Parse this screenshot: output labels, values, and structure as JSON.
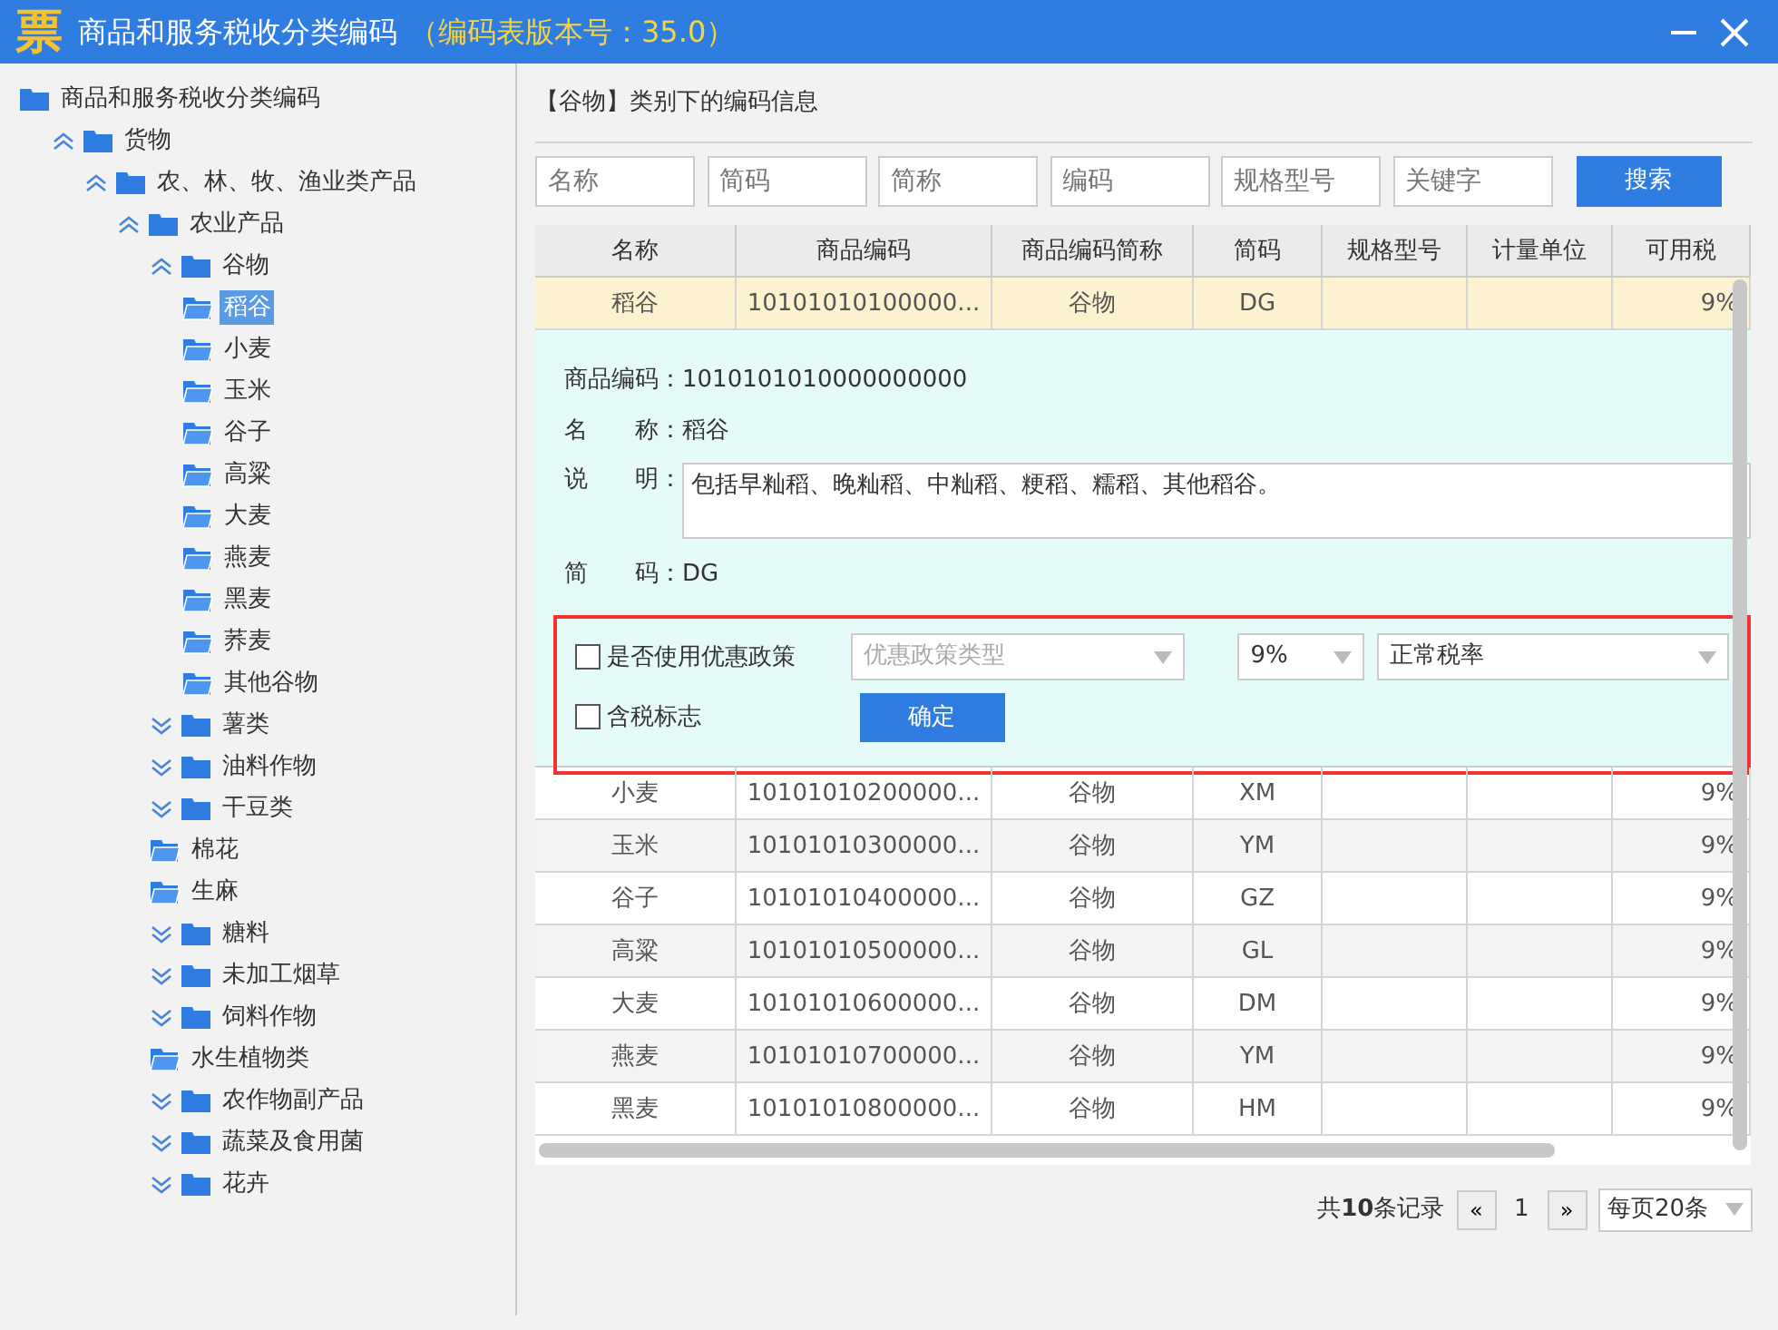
{
  "window": {
    "logo": "票",
    "title": "商品和服务税收分类编码",
    "version": "（编码表版本号：35.0）"
  },
  "tree": [
    {
      "label": "商品和服务税收分类编码",
      "kind": "root",
      "selected": false,
      "children": [
        {
          "label": "货物",
          "kind": "branch",
          "expanded": true,
          "selected": false,
          "children": [
            {
              "label": "农、林、牧、渔业类产品",
              "kind": "branch",
              "expanded": true,
              "selected": false,
              "children": [
                {
                  "label": "农业产品",
                  "kind": "branch",
                  "expanded": true,
                  "selected": false,
                  "children": [
                    {
                      "label": "谷物",
                      "kind": "branch",
                      "expanded": true,
                      "selected": false,
                      "children": [
                        {
                          "label": "稻谷",
                          "kind": "leaf",
                          "selected": true
                        },
                        {
                          "label": "小麦",
                          "kind": "leaf",
                          "selected": false
                        },
                        {
                          "label": "玉米",
                          "kind": "leaf",
                          "selected": false
                        },
                        {
                          "label": "谷子",
                          "kind": "leaf",
                          "selected": false
                        },
                        {
                          "label": "高粱",
                          "kind": "leaf",
                          "selected": false
                        },
                        {
                          "label": "大麦",
                          "kind": "leaf",
                          "selected": false
                        },
                        {
                          "label": "燕麦",
                          "kind": "leaf",
                          "selected": false
                        },
                        {
                          "label": "黑麦",
                          "kind": "leaf",
                          "selected": false
                        },
                        {
                          "label": "荞麦",
                          "kind": "leaf",
                          "selected": false
                        },
                        {
                          "label": "其他谷物",
                          "kind": "leaf",
                          "selected": false
                        }
                      ]
                    },
                    {
                      "label": "薯类",
                      "kind": "branch",
                      "expanded": false,
                      "selected": false
                    },
                    {
                      "label": "油料作物",
                      "kind": "branch",
                      "expanded": false,
                      "selected": false
                    },
                    {
                      "label": "干豆类",
                      "kind": "branch",
                      "expanded": false,
                      "selected": false
                    },
                    {
                      "label": "棉花",
                      "kind": "leaf",
                      "selected": false
                    },
                    {
                      "label": "生麻",
                      "kind": "leaf",
                      "selected": false
                    },
                    {
                      "label": "糖料",
                      "kind": "branch",
                      "expanded": false,
                      "selected": false
                    },
                    {
                      "label": "未加工烟草",
                      "kind": "branch",
                      "expanded": false,
                      "selected": false
                    },
                    {
                      "label": "饲料作物",
                      "kind": "branch",
                      "expanded": false,
                      "selected": false
                    },
                    {
                      "label": "水生植物类",
                      "kind": "leaf",
                      "selected": false
                    },
                    {
                      "label": "农作物副产品",
                      "kind": "branch",
                      "expanded": false,
                      "selected": false
                    },
                    {
                      "label": "蔬菜及食用菌",
                      "kind": "branch",
                      "expanded": false,
                      "selected": false
                    },
                    {
                      "label": "花卉",
                      "kind": "branch",
                      "expanded": false,
                      "selected": false
                    }
                  ]
                }
              ]
            }
          ]
        }
      ]
    }
  ],
  "panel_title": "【谷物】类别下的编码信息",
  "search": {
    "fields": [
      {
        "placeholder": "名称"
      },
      {
        "placeholder": "简码"
      },
      {
        "placeholder": "简称"
      },
      {
        "placeholder": "编码"
      },
      {
        "placeholder": "规格型号"
      },
      {
        "placeholder": "关键字"
      }
    ],
    "button": "搜索"
  },
  "table": {
    "columns": [
      "名称",
      "商品编码",
      "商品编码简称",
      "简码",
      "规格型号",
      "计量单位",
      "可用税"
    ],
    "rows": [
      {
        "cells": [
          "稻谷",
          "10101010100000...",
          "谷物",
          "DG",
          "",
          "",
          "9%"
        ],
        "selected": true
      },
      {
        "cells": [
          "小麦",
          "10101010200000...",
          "谷物",
          "XM",
          "",
          "",
          "9%"
        ],
        "selected": false
      },
      {
        "cells": [
          "玉米",
          "10101010300000...",
          "谷物",
          "YM",
          "",
          "",
          "9%"
        ],
        "selected": false
      },
      {
        "cells": [
          "谷子",
          "10101010400000...",
          "谷物",
          "GZ",
          "",
          "",
          "9%"
        ],
        "selected": false
      },
      {
        "cells": [
          "高粱",
          "10101010500000...",
          "谷物",
          "GL",
          "",
          "",
          "9%"
        ],
        "selected": false
      },
      {
        "cells": [
          "大麦",
          "10101010600000...",
          "谷物",
          "DM",
          "",
          "",
          "9%"
        ],
        "selected": false
      },
      {
        "cells": [
          "燕麦",
          "10101010700000...",
          "谷物",
          "YM",
          "",
          "",
          "9%"
        ],
        "selected": false
      },
      {
        "cells": [
          "黑麦",
          "10101010800000...",
          "谷物",
          "HM",
          "",
          "",
          "9%"
        ],
        "selected": false
      }
    ]
  },
  "detail": {
    "code_label": "商品编码：",
    "code": "1010101010000000000",
    "name_label": "名　　称：",
    "name": "稻谷",
    "desc_label": "说　　明：",
    "desc": "包括早籼稻、晚籼稻、中籼稻、粳稻、糯稻、其他稻谷。",
    "abbr_label": "简　　码：",
    "abbr": "DG",
    "policy": {
      "use_policy": {
        "label": "是否使用优惠政策",
        "checked": false
      },
      "policy_type": {
        "placeholder": "优惠政策类型",
        "disabled": true
      },
      "rate": "9%",
      "rate_type": "正常税率",
      "tax_included": {
        "label": "含税标志",
        "checked": false
      },
      "confirm": "确定"
    }
  },
  "pagination": {
    "total": "共**10**条记录",
    "prev": "«",
    "page": "1",
    "next": "»",
    "page_size": "每页20条"
  }
}
